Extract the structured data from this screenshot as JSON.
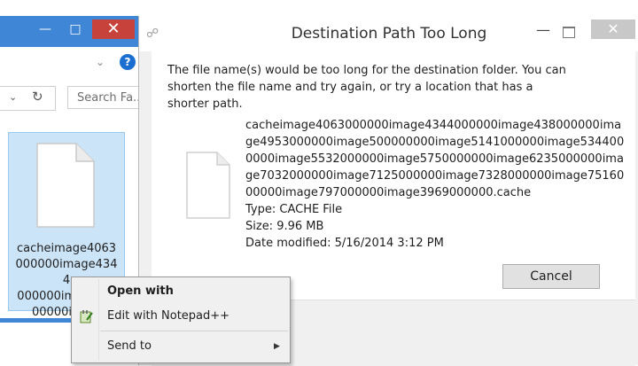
{
  "explorer": {
    "search_placeholder": "Search Fa...",
    "file_name": "cacheimage4063\n000000image4344\n000000im...4380\n00000ima...",
    "help_glyph": "?"
  },
  "dialog": {
    "title": "Destination Path Too Long",
    "message": "The file name(s) would be too long for the destination folder. You can shorten the file name and try again, or try a location that has a shorter path.",
    "file": {
      "name": "cacheimage4063000000image4344000000image438000000image4953000000image500000000image5141000000image5344000000image5532000000image5750000000image6235000000image7032000000image7125000000image7328000000image7516000000image797000000image3969000000.cache",
      "type": "Type: CACHE File",
      "size": "Size: 9.96 MB",
      "modified": "Date modified: 5/16/2014 3:12 PM"
    },
    "cancel_label": "Cancel"
  },
  "context_menu": {
    "items": [
      {
        "label": "Open with"
      },
      {
        "label": "Edit with Notepad++"
      },
      {
        "label": "Send to"
      }
    ]
  },
  "colors": {
    "explorer_title": "#3f86d6",
    "close_red": "#c7423a",
    "selection": "#cce4f7"
  }
}
